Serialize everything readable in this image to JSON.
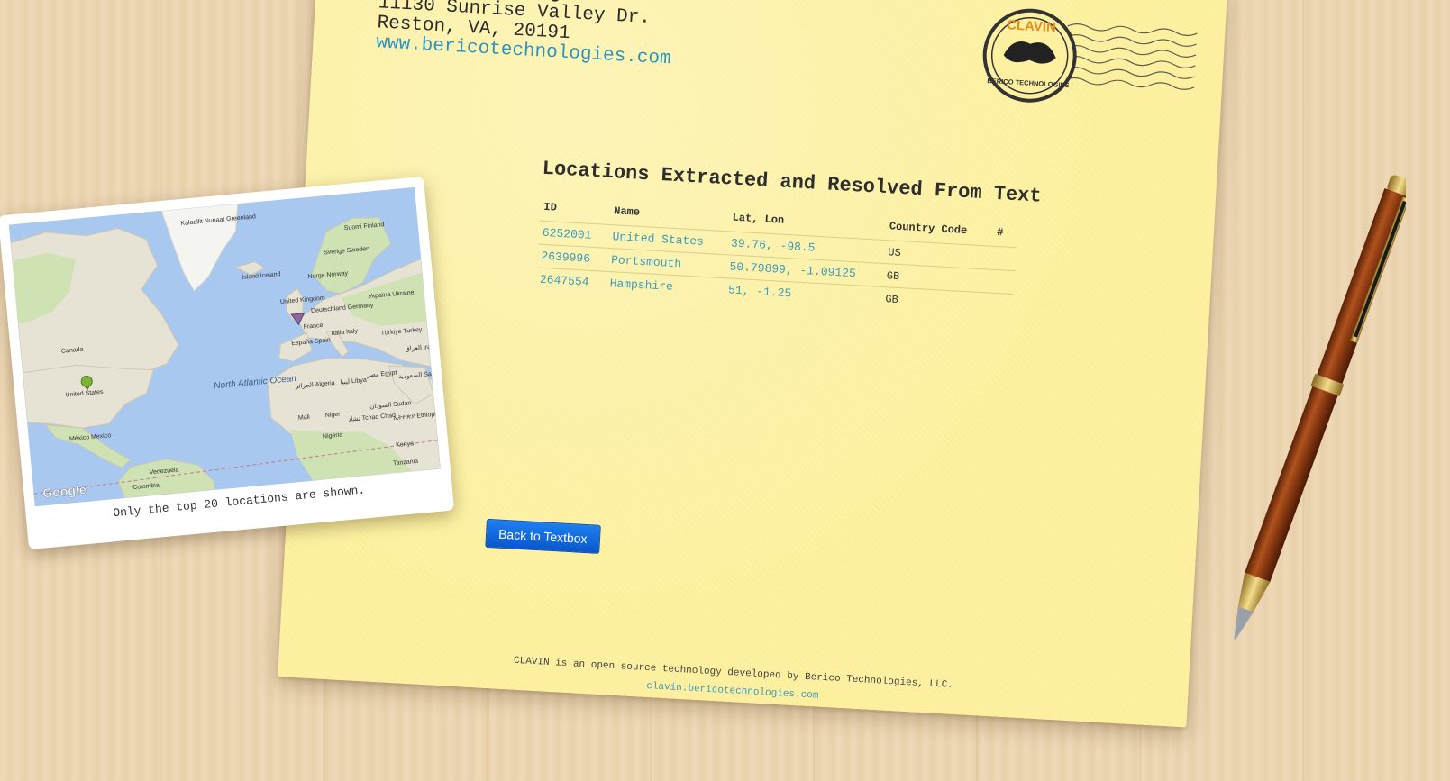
{
  "letter": {
    "company": "Berico Technologies",
    "street": "11130 Sunrise Valley Dr.",
    "city": "Reston, VA, 20191",
    "website": "www.bericotechnologies.com"
  },
  "postmark": {
    "top_text": "CLAVIN",
    "bottom_text": "BERICO TECHNOLOGIES"
  },
  "results": {
    "title": "Locations Extracted and Resolved From Text",
    "headers": {
      "id": "ID",
      "name": "Name",
      "latlon": "Lat, Lon",
      "country": "Country Code",
      "count": "#"
    },
    "rows": [
      {
        "id": "6252001",
        "name": "United States",
        "latlon": "39.76, -98.5",
        "country": "US",
        "count": ""
      },
      {
        "id": "2639996",
        "name": "Portsmouth",
        "latlon": "50.79899, -1.09125",
        "country": "GB",
        "count": ""
      },
      {
        "id": "2647554",
        "name": "Hampshire",
        "latlon": "51, -1.25",
        "country": "GB",
        "count": ""
      }
    ]
  },
  "buttons": {
    "back": "Back to Textbox"
  },
  "footer": {
    "text": "CLAVIN is an open source technology developed by Berico Technologies, LLC.",
    "link": "clavin.bericotechnologies.com"
  },
  "map": {
    "caption": "Only the top 20 locations are shown.",
    "attribution": "Google",
    "labels": {
      "greenland": "Kalaallit Nunaat Greenland",
      "iceland": "Ísland Iceland",
      "finland": "Suomi Finland",
      "sweden": "Sverige Sweden",
      "norway": "Norge Norway",
      "uk": "United Kingdom",
      "germany": "Deutschland Germany",
      "ukraine": "Україна Ukraine",
      "france": "France",
      "italy": "Italia Italy",
      "spain": "España Spain",
      "turkey": "Türkiye Turkey",
      "iraq": "العراق Iraq",
      "canada": "Canada",
      "united_states": "United States",
      "north_atlantic": "North Atlantic Ocean",
      "algeria": "الجزائر Algeria",
      "libya": "ليبيا Libya",
      "egypt": "مصر Egypt",
      "saudi": "السعودية Saudi Arabia",
      "mexico": "México Mexico",
      "mali": "Mali",
      "niger": "Niger",
      "chad": "تشاد Tchad Chad",
      "sudan": "السودان Sudan",
      "nigeria": "Nigeria",
      "ethiopia": "ኢትዮጵያ Ethiopia",
      "venezuela": "Venezuela",
      "colombia": "Colombia",
      "kenya": "Kenya",
      "tanzania": "Tanzania"
    },
    "colors": {
      "ocean": "#a9c8ef",
      "land": "#e7e3d4",
      "green": "#cfe2b3",
      "marker_us": "#7fb238",
      "marker_gb": "#8a6aa0"
    }
  },
  "colors": {
    "paper": "#fdf1a1",
    "link": "#3a9bbf",
    "button": "#1469e0",
    "postmark_orange": "#e48c1f"
  }
}
